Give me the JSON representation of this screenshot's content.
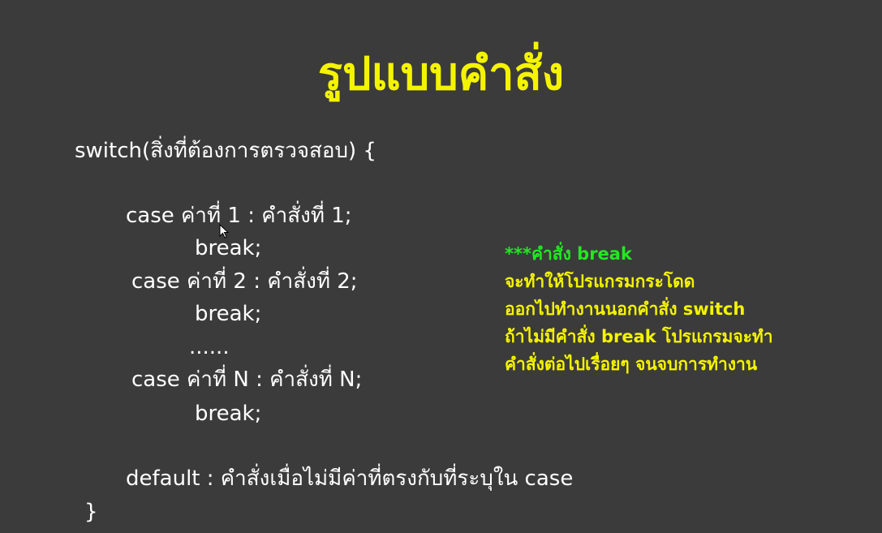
{
  "slide": {
    "title": "รูปแบบคำสั่ง",
    "code": [
      "switch(สิ่งที่ต้องการตรวจสอบ) {",
      "case ค่าที่ 1 : คำสั่งที่ 1;",
      "break;",
      "case ค่าที่ 2 : คำสั่งที่ 2;",
      "break;",
      "......",
      "case ค่าที่ N : คำสั่งที่ N;",
      "break;",
      "default : คำสั่งเมื่อไม่มีค่าที่ตรงกับที่ระบุใน case",
      "}"
    ],
    "note": {
      "heading": "***คำสั่ง break",
      "lines": [
        "จะทำให้โปรแกรมกระโดด",
        "ออกไปทำงานนอกคำสั่ง switch",
        "ถ้าไม่มีคำสั่ง break โปรแกรมจะทำ",
        "คำสั่งต่อไปเรื่อยๆ จนจบการทำงาน"
      ]
    },
    "colors": {
      "background": "#3b3b3b",
      "title": "#f4f400",
      "code_text": "#ffffff",
      "note_heading": "#22e822",
      "note_text": "#f4f400"
    }
  }
}
